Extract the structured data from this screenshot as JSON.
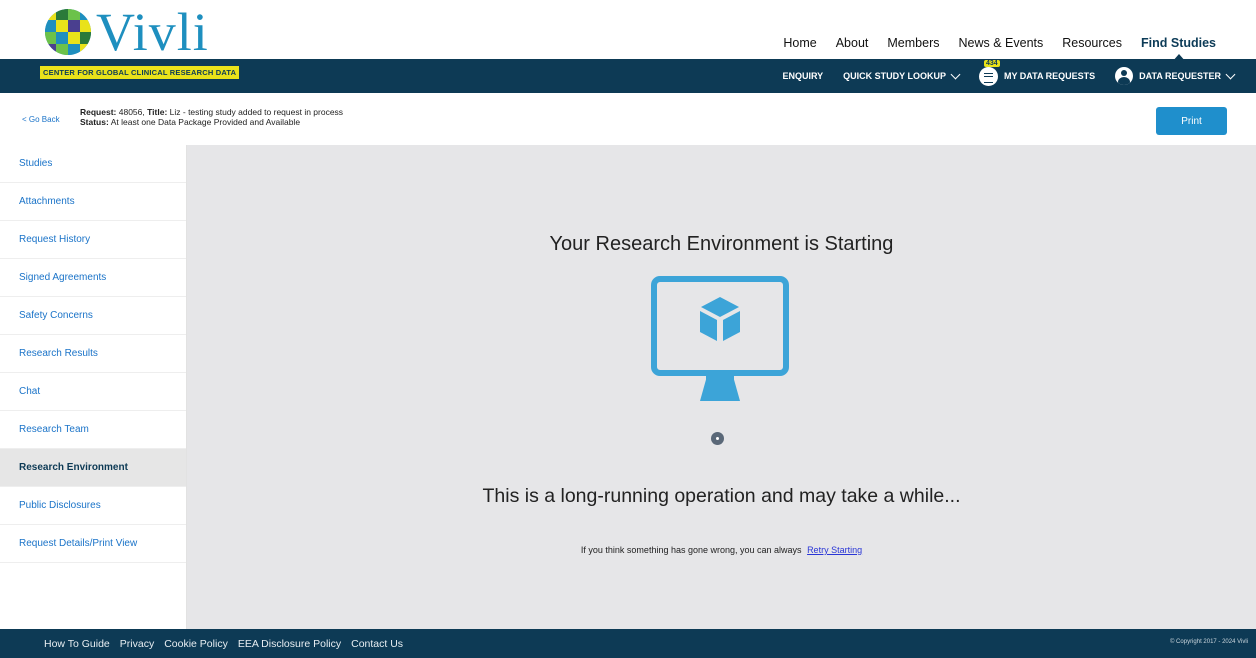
{
  "brand": {
    "name": "Vivli",
    "tagline": "CENTER FOR GLOBAL CLINICAL RESEARCH DATA",
    "colors": {
      "primary": "#0d3a55",
      "accent": "#1f8fcc",
      "highlight": "#e9e21a"
    }
  },
  "top_nav": {
    "items": [
      "Home",
      "About",
      "Members",
      "News & Events",
      "Resources",
      "Find Studies"
    ],
    "active": "Find Studies"
  },
  "sub_nav": {
    "enquiry": "ENQUIRY",
    "quick_lookup": "QUICK STUDY LOOKUP",
    "data_requests": "MY DATA REQUESTS",
    "data_requests_count": "434",
    "user": "DATA REQUESTER"
  },
  "request": {
    "go_back": "< Go Back",
    "request_label": "Request:",
    "request_id": "48056,",
    "title_label": "Title:",
    "title": "Liz - testing study added to request in process",
    "status_label": "Status:",
    "status": "At least one Data Package Provided and Available",
    "print": "Print"
  },
  "sidebar": {
    "items": [
      {
        "label": "Studies"
      },
      {
        "label": "Attachments"
      },
      {
        "label": "Request History"
      },
      {
        "label": "Signed Agreements"
      },
      {
        "label": "Safety Concerns"
      },
      {
        "label": "Research Results"
      },
      {
        "label": "Chat"
      },
      {
        "label": "Research Team"
      },
      {
        "label": "Research Environment"
      },
      {
        "label": "Public Disclosures"
      },
      {
        "label": "Request Details/Print View"
      }
    ],
    "active_index": 8
  },
  "main": {
    "title": "Your Research Environment is Starting",
    "message": "This is a long-running operation and may take a while...",
    "retry_prefix": "If you think something has gone wrong, you can always",
    "retry_link": "Retry Starting"
  },
  "footer": {
    "links": [
      "How To Guide",
      "Privacy",
      "Cookie Policy",
      "EEA Disclosure Policy",
      "Contact Us"
    ],
    "copyright": "© Copyright 2017 - 2024 Vivli"
  }
}
